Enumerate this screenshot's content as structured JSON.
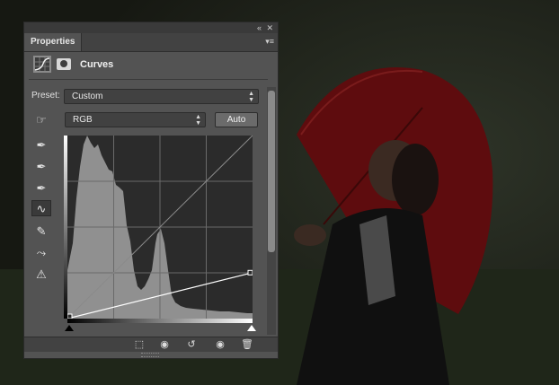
{
  "panel": {
    "tab_label": "Properties",
    "collapse_glyph": "«",
    "close_glyph": "✕",
    "menu_glyph": "▾≡"
  },
  "adjustment": {
    "title": "Curves",
    "icon": "curves-adjustment-icon",
    "mask_icon": "layer-mask-icon"
  },
  "preset": {
    "label": "Preset:",
    "value": "Custom"
  },
  "channel": {
    "value": "RGB"
  },
  "auto_button": {
    "label": "Auto"
  },
  "tools": [
    {
      "name": "on-image-adjust-icon",
      "glyph": "☞"
    },
    {
      "name": "sample-black-point-icon",
      "glyph": "✒"
    },
    {
      "name": "sample-gray-point-icon",
      "glyph": "✒"
    },
    {
      "name": "sample-white-point-icon",
      "glyph": "✒"
    },
    {
      "name": "edit-points-curve-icon",
      "glyph": "∿"
    },
    {
      "name": "draw-pencil-icon",
      "glyph": "✎"
    },
    {
      "name": "smooth-curve-icon",
      "glyph": "⤳"
    },
    {
      "name": "clipping-warning-icon",
      "glyph": "⚠"
    }
  ],
  "curve": {
    "input_black": 0,
    "input_white": 255,
    "points": [
      [
        0,
        0
      ],
      [
        255,
        64
      ]
    ]
  },
  "bottom_icons": [
    {
      "name": "clip-to-layer-icon",
      "glyph": "⬚"
    },
    {
      "name": "view-previous-state-icon",
      "glyph": "◉"
    },
    {
      "name": "reset-adjustment-icon",
      "glyph": "↺"
    },
    {
      "name": "toggle-visibility-icon",
      "glyph": "◉"
    },
    {
      "name": "delete-layer-icon",
      "glyph": "🗑"
    }
  ],
  "colors": {
    "panel_bg": "#535353",
    "umbrella": "#7a1010"
  }
}
